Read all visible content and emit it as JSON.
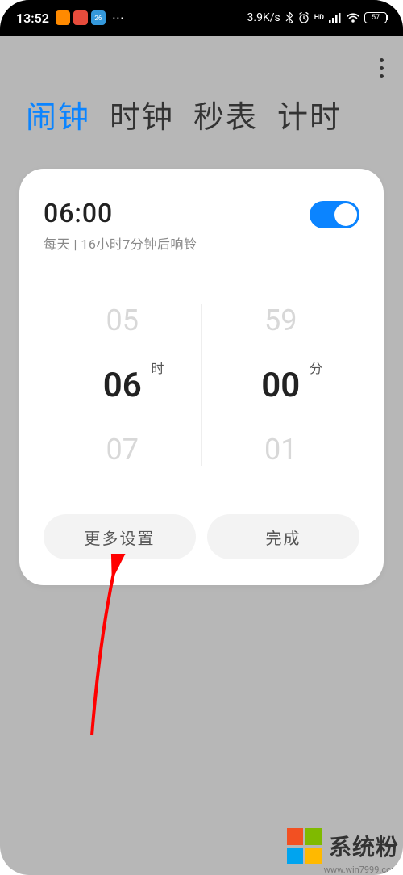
{
  "statusBar": {
    "time": "13:52",
    "network": "3.9K/s",
    "battery": "57",
    "app_badge": "26"
  },
  "tabs": {
    "alarm": "闹钟",
    "clock": "时钟",
    "stopwatch": "秒表",
    "timer": "计时"
  },
  "alarm": {
    "time": "06:00",
    "desc": "每天 | 16小时7分钟后响铃",
    "toggle_on": true
  },
  "picker": {
    "hour_prev": "05",
    "hour_sel": "06",
    "hour_next": "07",
    "hour_unit": "时",
    "min_prev": "59",
    "min_sel": "00",
    "min_next": "01",
    "min_unit": "分"
  },
  "buttons": {
    "more": "更多设置",
    "done": "完成"
  },
  "watermark": {
    "text": "系统粉",
    "url": "www.win7999.com"
  }
}
